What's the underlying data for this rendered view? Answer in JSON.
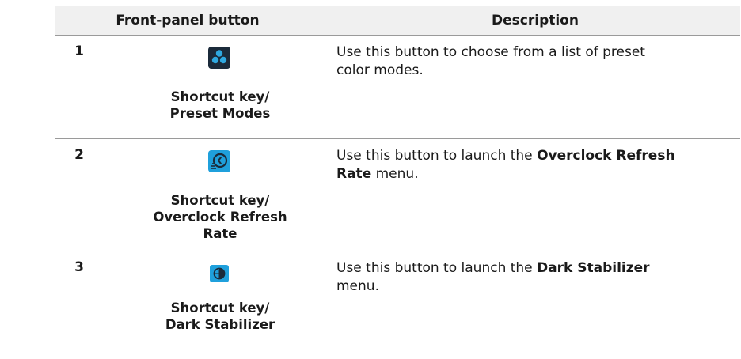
{
  "header": {
    "col1": "Front-panel button",
    "col2": "Description"
  },
  "rows": [
    {
      "number": "1",
      "icon": "preset-modes-icon",
      "label_line1": "Shortcut key/",
      "label_line2": "Preset Modes",
      "desc_line1": "Use this button to choose from a list of preset",
      "desc_line2": "color modes."
    },
    {
      "number": "2",
      "icon": "overclock-refresh-rate-icon",
      "label_line1": "Shortcut key/",
      "label_line2": "Overclock Refresh",
      "label_line3": "Rate",
      "desc_pre": "Use this button to launch the ",
      "desc_bold1": "Overclock Refresh",
      "desc_bold2": "Rate",
      "desc_post": " menu."
    },
    {
      "number": "3",
      "icon": "dark-stabilizer-icon",
      "label_line1": "Shortcut key/",
      "label_line2": "Dark Stabilizer",
      "desc_pre": "Use this button to launch the ",
      "desc_bold": "Dark Stabilizer",
      "desc_post": "menu."
    }
  ],
  "colors": {
    "icon_blue": "#1fa0dc",
    "icon_dark": "#1b2a3a",
    "rule": "#9a9a9a",
    "header_bg": "#f0f0f0"
  }
}
